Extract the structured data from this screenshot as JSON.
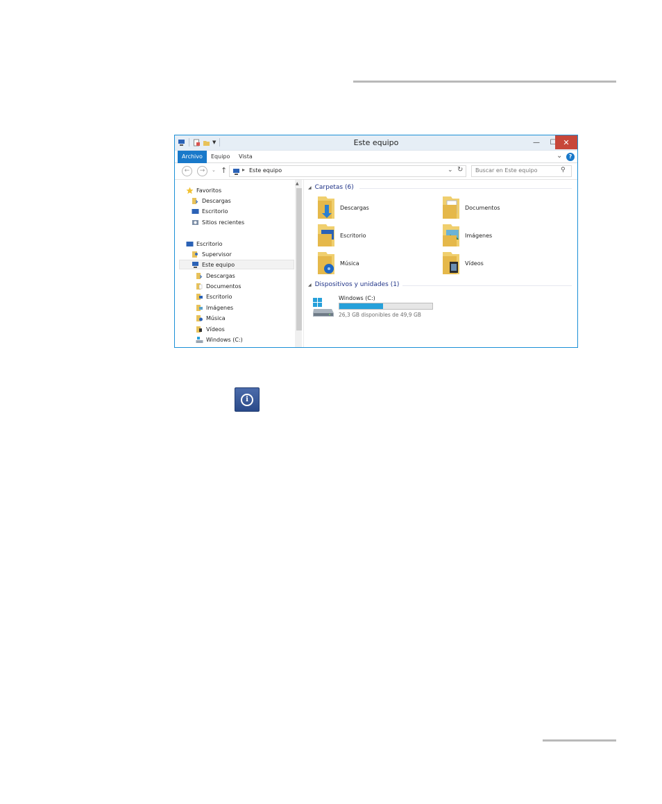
{
  "window": {
    "title": "Este equipo",
    "tabs": [
      "Archivo",
      "Equipo",
      "Vista"
    ],
    "address": "Este equipo",
    "search_placeholder": "Buscar en Este equipo"
  },
  "nav_pane": {
    "favoritos": "Favoritos",
    "fav_items": [
      "Descargas",
      "Escritorio",
      "Sitios recientes"
    ],
    "escritorio": "Escritorio",
    "supervisor": "Supervisor",
    "este_equipo": "Este equipo",
    "equipo_items": [
      "Descargas",
      "Documentos",
      "Escritorio",
      "Imágenes",
      "Música",
      "Vídeos",
      "Windows (C:)"
    ]
  },
  "content": {
    "folders_group": "Carpetas (6)",
    "folders": [
      "Descargas",
      "Documentos",
      "Escritorio",
      "Imágenes",
      "Música",
      "Vídeos"
    ],
    "devices_group": "Dispositivos y unidades (1)",
    "drive_name": "Windows (C:)",
    "drive_free": "26,3 GB disponibles de 49,9 GB",
    "drive_used_fraction": 0.473
  },
  "colors": {
    "accent": "#1979ca",
    "close": "#c7473a",
    "group_heading": "#1e3287",
    "drive_fill": "#26a0da",
    "info_icon": "#2a4a8a"
  },
  "icons": [
    "back-icon",
    "forward-icon",
    "up-icon",
    "refresh-icon",
    "search-icon",
    "help-icon",
    "folder-icon",
    "drive-icon",
    "info-icon"
  ]
}
